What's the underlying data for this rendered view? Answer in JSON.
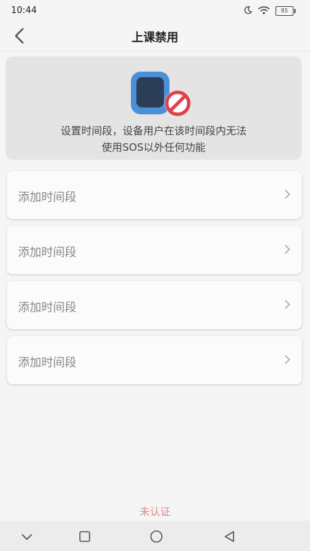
{
  "status_bar": {
    "time": "10:44",
    "battery": "85",
    "moon_icon": "moon-icon",
    "wifi_icon": "wifi-icon"
  },
  "header": {
    "title": "上课禁用",
    "back_icon": "chevron-left-icon"
  },
  "info": {
    "line1": "设置时间段，设备用户在该时间段内无法",
    "line2": "使用SOS以外任何功能",
    "icon": "watch-forbidden-icon",
    "colors": {
      "watch_blue": "#4a90d9",
      "forbid_red": "#e0404a"
    }
  },
  "slots": [
    {
      "label": "添加时间段"
    },
    {
      "label": "添加时间段"
    },
    {
      "label": "添加时间段"
    },
    {
      "label": "添加时间段"
    }
  ],
  "footer": {
    "status": "未认证",
    "color": "#e08a8a"
  },
  "system_nav": {
    "back": "triangle-back-icon",
    "home": "circle-home-icon",
    "recents": "square-recents-icon",
    "collapse": "chevron-down-icon"
  }
}
